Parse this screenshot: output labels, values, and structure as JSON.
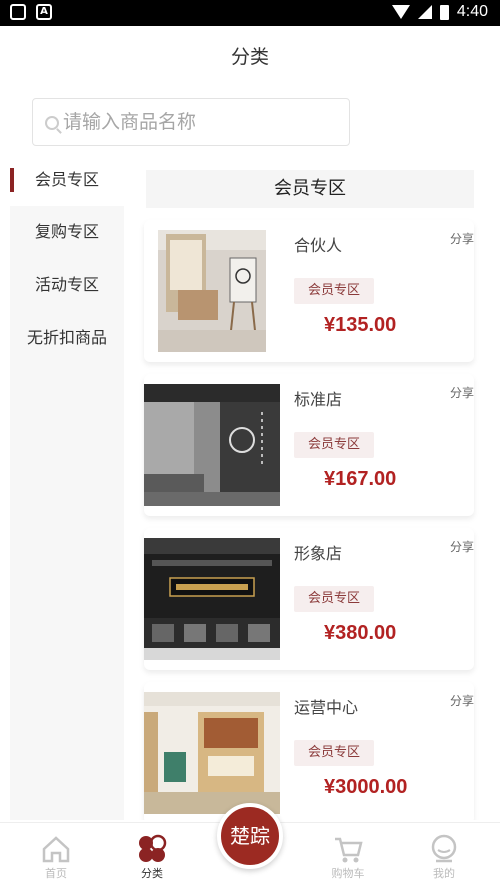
{
  "status_bar": {
    "time": "4:40",
    "app_icon_label": "A"
  },
  "header": {
    "title": "分类"
  },
  "search": {
    "placeholder": "请输入商品名称",
    "value": ""
  },
  "sidebar": {
    "items": [
      {
        "label": "会员专区",
        "active": true
      },
      {
        "label": "复购专区",
        "active": false
      },
      {
        "label": "活动专区",
        "active": false
      },
      {
        "label": "无折扣商品",
        "active": false
      }
    ]
  },
  "main": {
    "section_title": "会员专区",
    "products": [
      {
        "name": "合伙人",
        "tag": "会员专区",
        "price": "¥135.00",
        "share": "分享"
      },
      {
        "name": "标准店",
        "tag": "会员专区",
        "price": "¥167.00",
        "share": "分享"
      },
      {
        "name": "形象店",
        "tag": "会员专区",
        "price": "¥380.00",
        "share": "分享"
      },
      {
        "name": "运营中心",
        "tag": "会员专区",
        "price": "¥3000.00",
        "share": "分享"
      }
    ]
  },
  "tabbar": {
    "items": [
      {
        "label": "首页",
        "icon": "home-icon"
      },
      {
        "label": "分类",
        "icon": "category-icon",
        "active": true
      },
      {
        "label": "楚踪",
        "icon": "brand-logo"
      },
      {
        "label": "购物车",
        "icon": "cart-icon"
      },
      {
        "label": "我的",
        "icon": "profile-icon"
      }
    ]
  },
  "colors": {
    "accent": "#8b2323",
    "price": "#b22222",
    "tag_bg": "#f6eeee"
  }
}
